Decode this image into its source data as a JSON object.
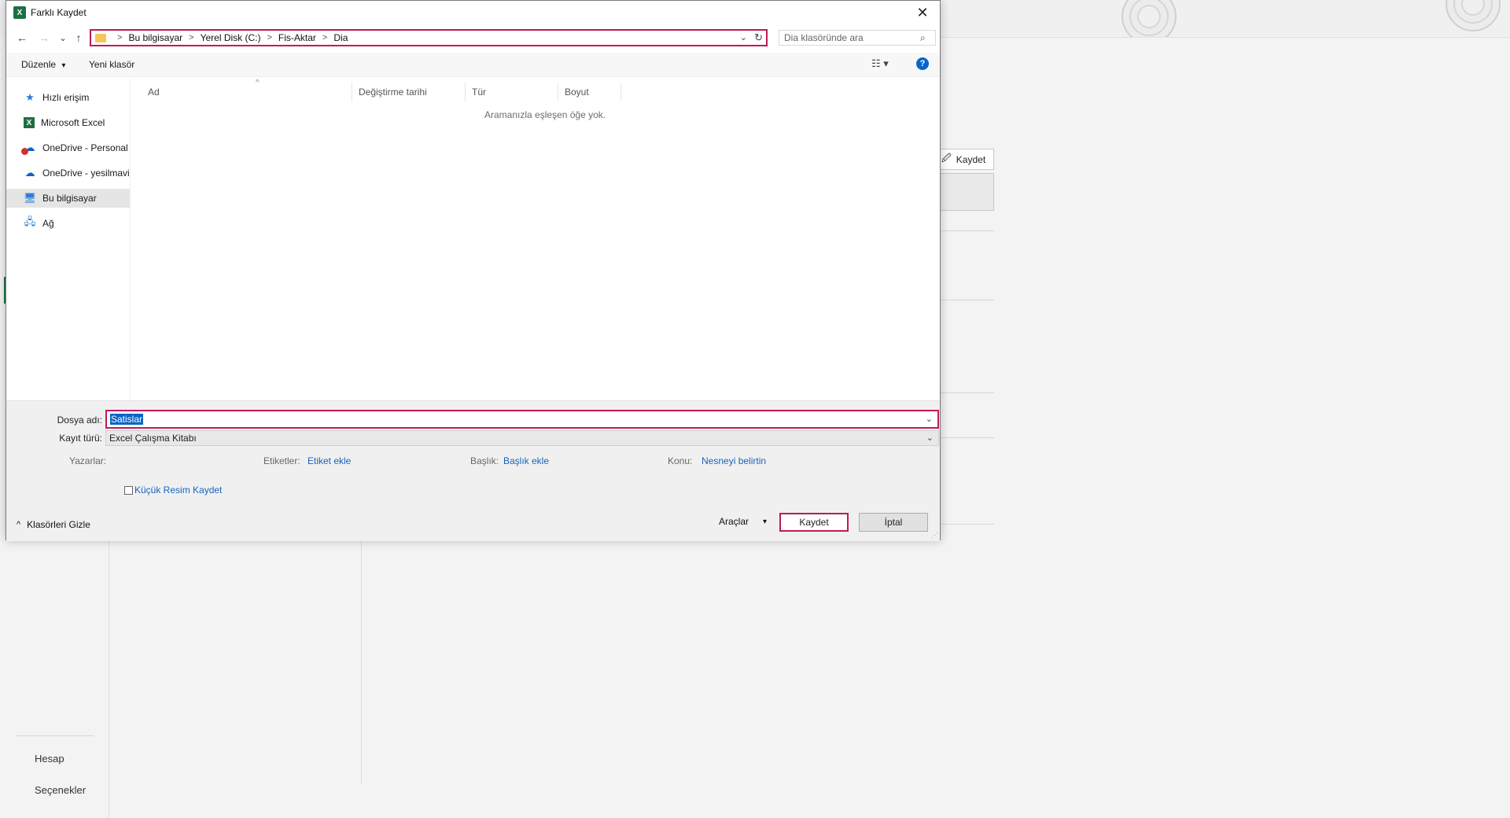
{
  "dialog": {
    "title": "Farklı Kaydet",
    "app_icon_text": "X",
    "close_glyph": "✕",
    "nav": {
      "back": "←",
      "forward": "→",
      "recent": "⌄",
      "up": "↑"
    },
    "address": {
      "crumbs": [
        "Bu bilgisayar",
        "Yerel Disk (C:)",
        "Fis-Aktar",
        "Dia"
      ],
      "separator": ">",
      "dropdown": "⌄",
      "refresh": "↻"
    },
    "search": {
      "placeholder": "Dia klasöründe ara",
      "icon": "⌕"
    },
    "toolbar": {
      "organize": "Düzenle",
      "organize_caret": "▾",
      "new_folder": "Yeni klasör",
      "view_icon": "☷ ▾",
      "help": "?"
    },
    "sidebar": {
      "items": [
        {
          "label": "Hızlı erişim",
          "icon": "★",
          "icon_name": "quick-access-star-icon",
          "color": "#2b7cd3"
        },
        {
          "label": "Microsoft Excel",
          "icon": "X",
          "icon_name": "excel-icon",
          "color": "#1d6f42"
        },
        {
          "label": "OneDrive - Personal",
          "icon": "☁",
          "icon_name": "onedrive-error-icon",
          "color": "#0a64c8"
        },
        {
          "label": "OneDrive - yesilmavi",
          "icon": "☁",
          "icon_name": "onedrive-icon",
          "color": "#0a64c8"
        },
        {
          "label": "Bu bilgisayar",
          "icon": "🖥",
          "icon_name": "this-pc-icon",
          "color": "#2b7cd3"
        },
        {
          "label": "Ağ",
          "icon": "🖧",
          "icon_name": "network-icon",
          "color": "#2b7cd3"
        }
      ],
      "selected_index": 4
    },
    "columns": [
      "Ad",
      "Değiştirme tarihi",
      "Tür",
      "Boyut"
    ],
    "sort_caret": "^",
    "empty_message": "Aramanızla eşleşen öğe yok.",
    "form": {
      "filename_label": "Dosya adı:",
      "filename_value": "Satislar",
      "filetype_label": "Kayıt türü:",
      "filetype_value": "Excel Çalışma Kitabı",
      "dropdown": "⌄"
    },
    "meta": {
      "authors_label": "Yazarlar:",
      "tags_label": "Etiketler:",
      "tags_link": "Etiket ekle",
      "title_label": "Başlık:",
      "title_link": "Başlık ekle",
      "subject_label": "Konu:",
      "subject_link": "Nesneyi belirtin"
    },
    "thumbnail_label": "Küçük Resim Kaydet",
    "hide_folders": "Klasörleri Gizle",
    "hide_folders_caret": "^",
    "tools_label": "Araçlar",
    "tools_caret": "▾",
    "save_button": "Kaydet",
    "cancel_button": "İptal",
    "grip": "⋰"
  },
  "background": {
    "left_nav": {
      "account": "Hesap",
      "options": "Seçenekler"
    },
    "save_panel_button": "Kaydet",
    "save_panel_icon": "🖉"
  }
}
